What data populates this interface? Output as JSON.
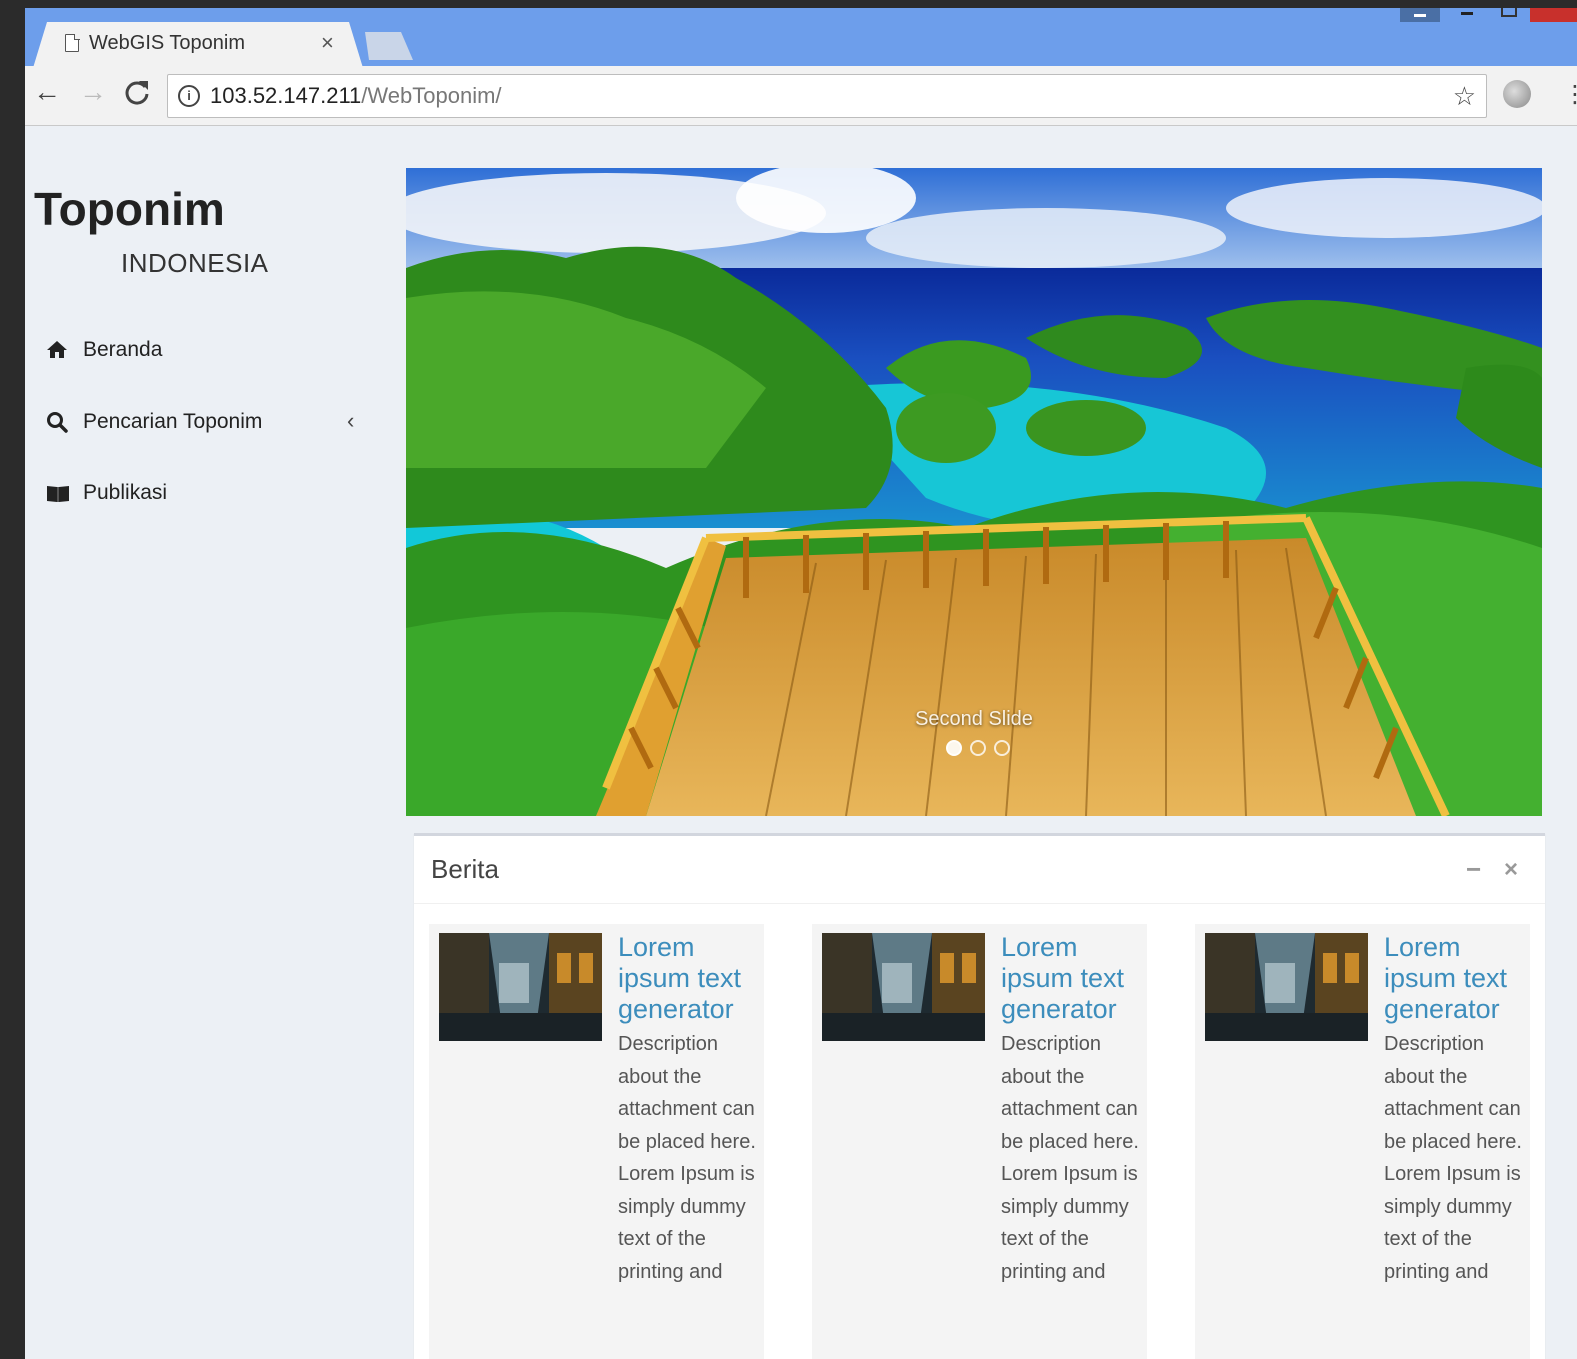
{
  "browser": {
    "tab_title": "WebGIS Toponim",
    "tab_close": "×",
    "url_host": "103.52.147.211",
    "url_path": "/WebToponim/"
  },
  "sidebar": {
    "logo_title": "Toponim",
    "logo_subtitle": "INDONESIA",
    "items": [
      {
        "label": "Beranda",
        "icon": "home-icon"
      },
      {
        "label": "Pencarian Toponim",
        "icon": "search-icon",
        "chevron": "‹"
      },
      {
        "label": "Publikasi",
        "icon": "book-icon"
      }
    ]
  },
  "carousel": {
    "caption": "Second Slide",
    "slide_count": 3,
    "active_index": 0
  },
  "news_box": {
    "title": "Berita",
    "minimize_label": "−",
    "close_label": "×",
    "cards": [
      {
        "title": "Lorem ipsum text generator",
        "description": "Description about the attachment can be placed here. Lorem Ipsum is simply dummy text of the printing and"
      },
      {
        "title": "Lorem ipsum text generator",
        "description": "Description about the attachment can be placed here. Lorem Ipsum is simply dummy text of the printing and"
      },
      {
        "title": "Lorem ipsum text generator",
        "description": "Description about the attachment can be placed here. Lorem Ipsum is simply dummy text of the printing and"
      }
    ]
  },
  "colors": {
    "tabstrip": "#6d9eeb",
    "link": "#3c8dbc",
    "page_bg": "#ecf0f5"
  }
}
